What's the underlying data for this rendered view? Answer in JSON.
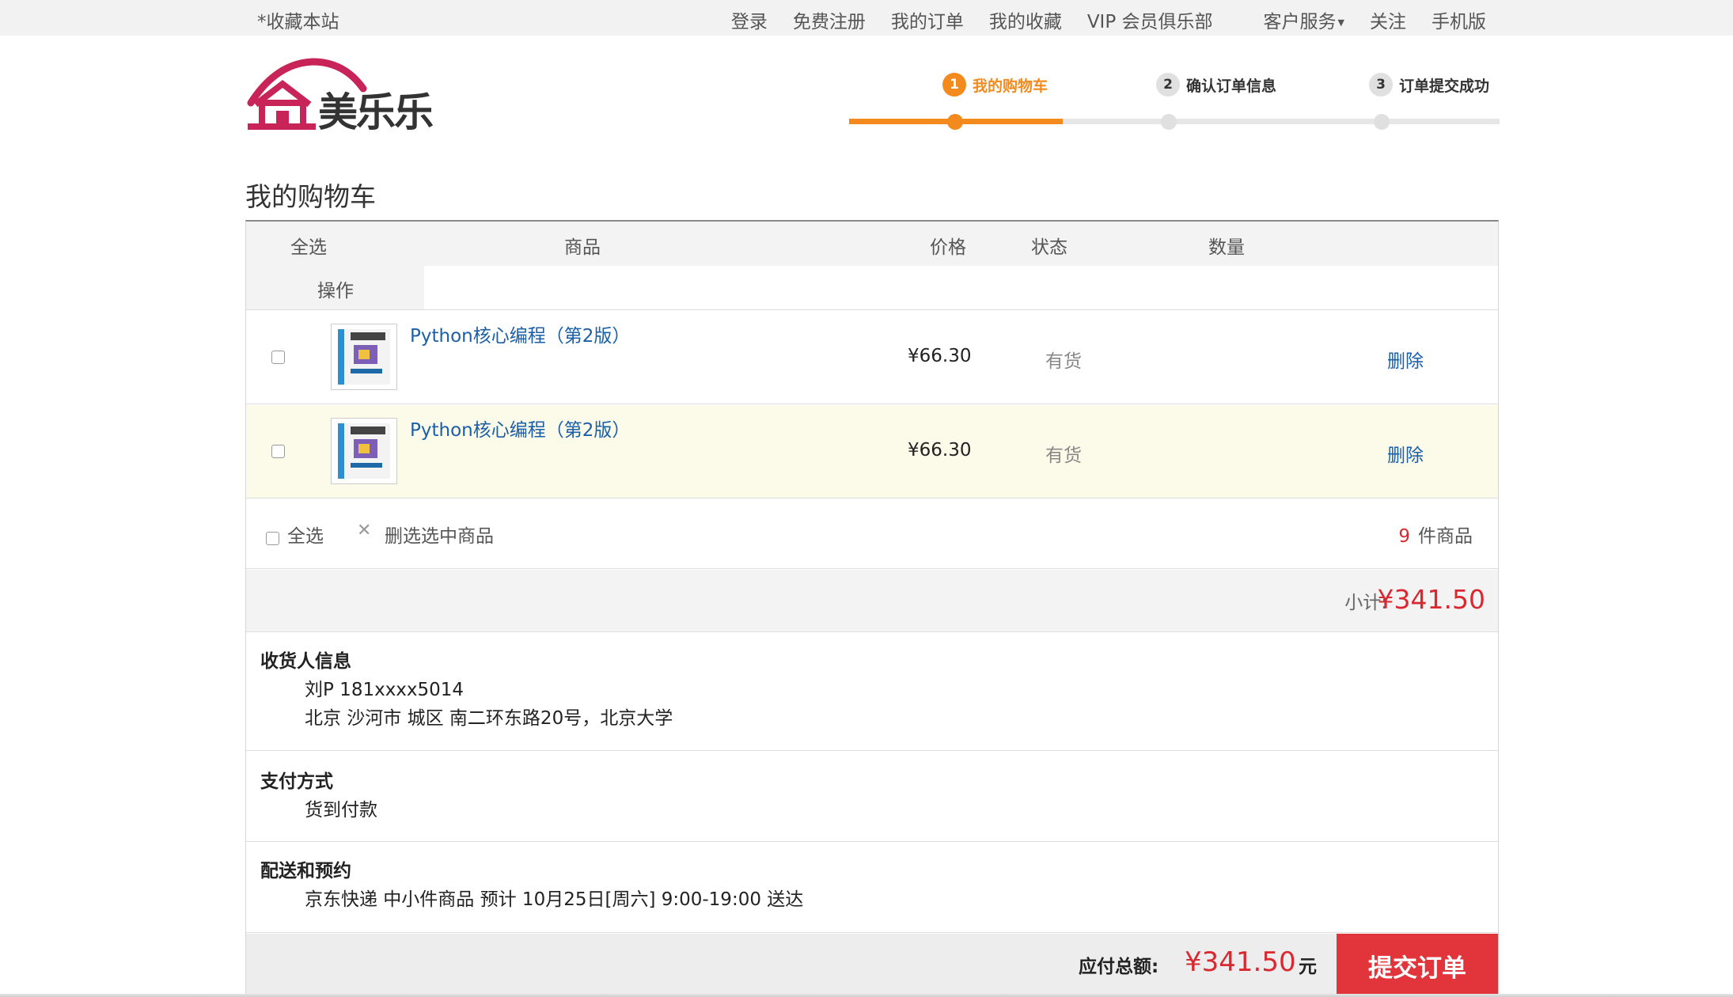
{
  "topbar": {
    "favorite": "*收藏本站",
    "links": [
      "登录",
      "免费注册",
      "我的订单",
      "我的收藏",
      "VIP 会员俱乐部",
      "客户服务",
      "关注",
      "手机版"
    ]
  },
  "logo": {
    "text": "美乐乐"
  },
  "steps": [
    {
      "num": "1",
      "label": "我的购物车"
    },
    {
      "num": "2",
      "label": "确认订单信息"
    },
    {
      "num": "3",
      "label": "订单提交成功"
    }
  ],
  "page_title": "我的购物车",
  "table_header": {
    "select_all": "全选",
    "product": "商品",
    "price": "价格",
    "status": "状态",
    "quantity": "数量",
    "operation": "操作"
  },
  "items": [
    {
      "name": "Python核心编程（第2版）",
      "price": "¥66.30",
      "status": "有货",
      "delete": "删除"
    },
    {
      "name": "Python核心编程（第2版）",
      "price": "¥66.30",
      "status": "有货",
      "delete": "删除"
    }
  ],
  "cart_footer": {
    "select_all": "全选",
    "delete_selected": "删选选中商品",
    "count": "9",
    "count_unit": "件商品"
  },
  "subtotal": {
    "label": "小计:",
    "value": "¥341.50"
  },
  "consignee": {
    "title": "收货人信息",
    "name_phone": "刘P 181xxxx5014",
    "address": "北京 沙河市 城区 南二环东路20号，北京大学"
  },
  "payment": {
    "title": "支付方式",
    "method": "货到付款"
  },
  "delivery": {
    "title": "配送和预约",
    "detail": "京东快递 中小件商品 预计 10月25日[周六] 9:00-19:00 送达"
  },
  "total": {
    "label": "应付总额:",
    "value": "¥341.50",
    "unit": "元",
    "submit": "提交订单"
  },
  "colors": {
    "accent": "#f28a1e",
    "price_red": "#d9282f",
    "link_blue": "#1a5fa8",
    "submit_red": "#e2353b",
    "logo_pink": "#c8245a"
  }
}
